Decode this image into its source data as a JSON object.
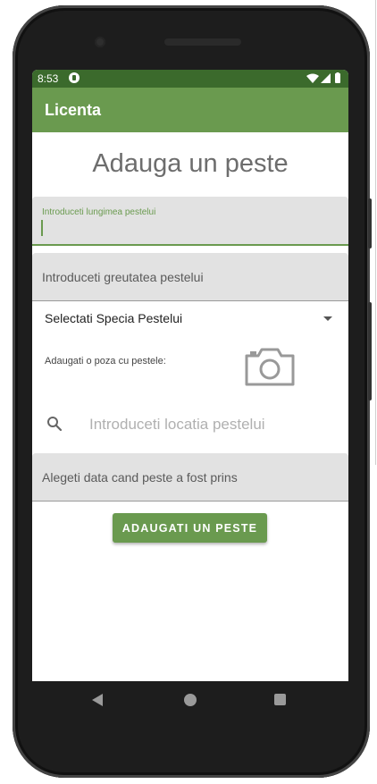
{
  "status_bar": {
    "time": "8:53"
  },
  "app_bar": {
    "title": "Licenta"
  },
  "page": {
    "title": "Adauga un peste"
  },
  "form": {
    "length": {
      "label": "Introduceti lungimea pestelui",
      "value": ""
    },
    "weight": {
      "placeholder": "Introduceti greutatea pestelui"
    },
    "species": {
      "selected": "Selectati Specia Pestelui"
    },
    "photo": {
      "label": "Adaugati o poza cu pestele:"
    },
    "location": {
      "placeholder": "Introduceti locatia pestelui"
    },
    "date": {
      "placeholder": "Alegeti data cand peste a fost prins"
    },
    "submit_label": "ADAUGATI UN PESTE"
  },
  "colors": {
    "status_bar": "#3b6a2c",
    "app_bar": "#6a9a4f",
    "accent": "#6a9a4f",
    "field_bg": "#e2e2e2"
  },
  "icons": {
    "status": [
      "g-icon",
      "wifi-icon",
      "signal-icon",
      "battery-icon"
    ],
    "photo": "camera-icon",
    "location": "search-icon",
    "spinner": "dropdown-arrow-icon",
    "nav": [
      "nav-back-icon",
      "nav-home-icon",
      "nav-recents-icon"
    ]
  }
}
